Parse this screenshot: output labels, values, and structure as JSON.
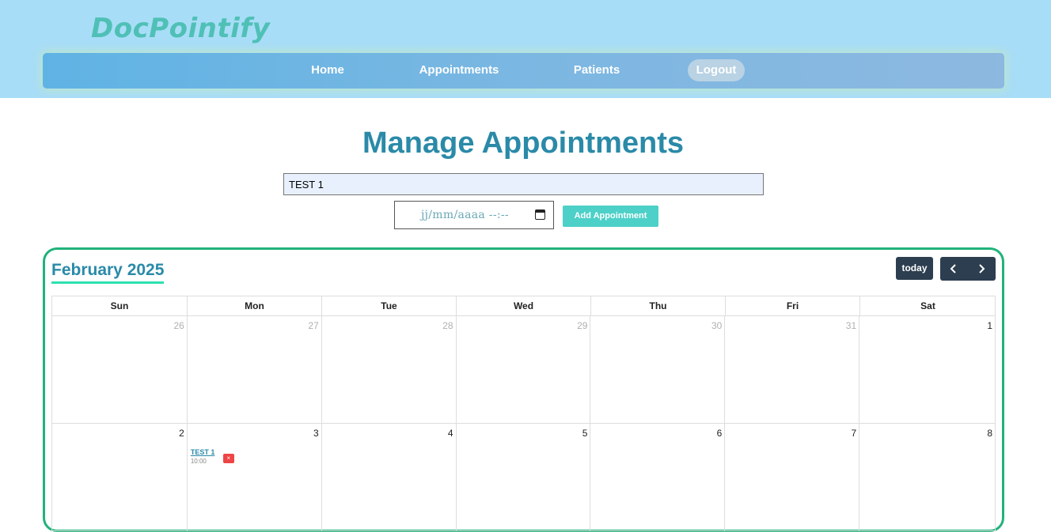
{
  "header": {
    "brand": "DocPointify",
    "nav": {
      "home": "Home",
      "appointments": "Appointments",
      "patients": "Patients",
      "logout": "Logout"
    }
  },
  "main": {
    "title": "Manage Appointments",
    "patient_input_value": "TEST 1",
    "date_placeholder": "jj/mm/aaaa --:--",
    "add_button": "Add Appointment"
  },
  "calendar": {
    "month_title": "February 2025",
    "today_button": "today",
    "weekdays": [
      "Sun",
      "Mon",
      "Tue",
      "Wed",
      "Thu",
      "Fri",
      "Sat"
    ],
    "weeks": [
      [
        {
          "num": "26",
          "other": true
        },
        {
          "num": "27",
          "other": true
        },
        {
          "num": "28",
          "other": true
        },
        {
          "num": "29",
          "other": true
        },
        {
          "num": "30",
          "other": true
        },
        {
          "num": "31",
          "other": true
        },
        {
          "num": "1",
          "other": false
        }
      ],
      [
        {
          "num": "2",
          "other": false
        },
        {
          "num": "3",
          "other": false,
          "event": {
            "title": "TEST 1",
            "time": "10:00",
            "delete": "×"
          }
        },
        {
          "num": "4",
          "other": false
        },
        {
          "num": "5",
          "other": false
        },
        {
          "num": "6",
          "other": false
        },
        {
          "num": "7",
          "other": false
        },
        {
          "num": "8",
          "other": false
        }
      ]
    ]
  }
}
